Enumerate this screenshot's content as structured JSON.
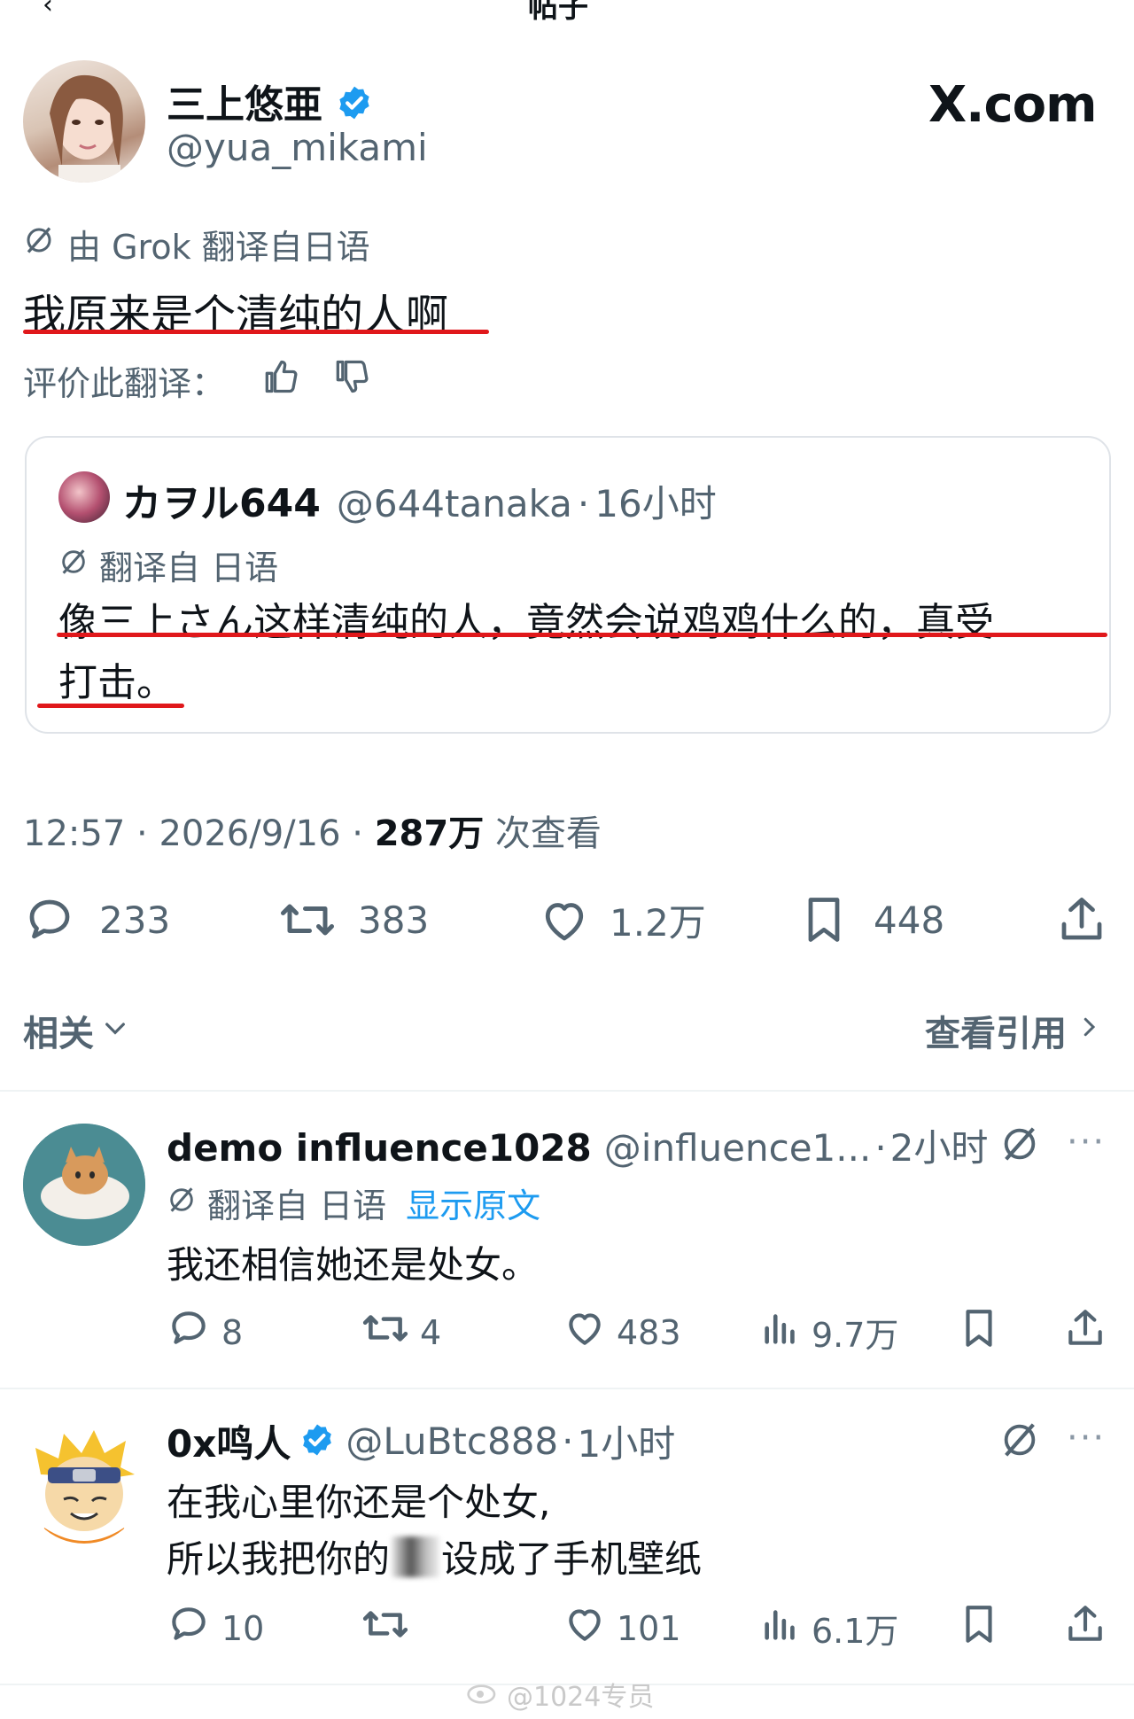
{
  "header": {
    "title": "帖子",
    "back_icon": "back-arrow-icon"
  },
  "post": {
    "author_name": "三上悠亜",
    "author_handle": "@yua_mikami",
    "verified": true,
    "brand": "X.com",
    "translation_note": "由 Grok 翻译自日语",
    "text": "我原来是个清纯的人啊",
    "rate_label": "评价此翻译：",
    "quote": {
      "author_name": "カヲル644",
      "author_handle": "@644tanaka",
      "time": "16小时",
      "translation_note": "翻译自 日语",
      "text_line1": "像三上さん这样清纯的人，竟然会说鸡鸡什么的，真受",
      "text_line2": "打击。"
    },
    "time": "12:57",
    "date": "2026/9/16",
    "views_count": "287万",
    "views_label": "次查看",
    "stats": {
      "replies": "233",
      "reposts": "383",
      "likes": "1.2万",
      "bookmarks": "448"
    }
  },
  "related": {
    "label": "相关",
    "view_quotes": "查看引用"
  },
  "replies": [
    {
      "name": "demo influence1028",
      "handle": "@influence1...",
      "time": "2小时",
      "translation_note": "翻译自 日语",
      "show_original": "显示原文",
      "text": "我还相信她还是处女。",
      "stats": {
        "replies": "8",
        "reposts": "4",
        "likes": "483",
        "views": "9.7万"
      }
    },
    {
      "name": "0x鸣人",
      "handle": "@LuBtc888",
      "time": "1小时",
      "verified": true,
      "text_line1": "在我心里你还是个处女,",
      "text_line2a": "所以我把你的",
      "text_line2b": "设成了手机壁纸",
      "stats": {
        "replies": "10",
        "reposts": "",
        "likes": "101",
        "views": "6.1万"
      }
    }
  ],
  "watermark": "@1024专员",
  "colors": {
    "verified": "#1d9bf0",
    "underline": "#e0181b",
    "link": "#1d9bf0"
  }
}
